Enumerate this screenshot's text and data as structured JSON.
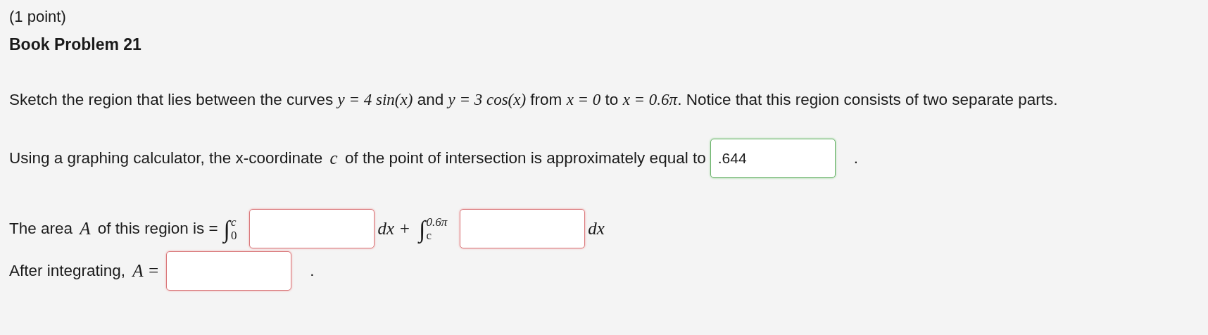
{
  "points": "(1 point)",
  "title": "Book Problem 21",
  "intro": [
    {
      "kind": "text",
      "text": "Sketch the region that lies between the curves "
    },
    {
      "kind": "math",
      "text": "y = 4 sin(x)"
    },
    {
      "kind": "text",
      "text": " and "
    },
    {
      "kind": "math",
      "text": "y = 3 cos(x)"
    },
    {
      "kind": "text",
      "text": " from "
    },
    {
      "kind": "math",
      "text": "x = 0"
    },
    {
      "kind": "text",
      "text": " to "
    },
    {
      "kind": "math",
      "text": "x = 0.6π"
    },
    {
      "kind": "text",
      "text": ". Notice that this region consists of two separate parts."
    }
  ],
  "rows": [
    {
      "parts": [
        {
          "kind": "text",
          "text": "Using a graphing calculator, the x-coordinate "
        },
        {
          "kind": "math",
          "text": "c"
        },
        {
          "kind": "text",
          "text": " of the point of intersection is approximately equal to"
        },
        {
          "kind": "field",
          "value": ".644",
          "correct": true
        },
        {
          "kind": "period",
          "text": "."
        }
      ]
    },
    {
      "parts": [
        {
          "kind": "text",
          "text": "The area "
        },
        {
          "kind": "math",
          "text": "A"
        },
        {
          "kind": "text",
          "text": " of this region is ="
        },
        {
          "kind": "integral",
          "sign": "∫",
          "upper": "c",
          "lower": "0"
        },
        {
          "kind": "field",
          "correct": false
        },
        {
          "kind": "math",
          "text": "dx +"
        },
        {
          "kind": "integral",
          "sign": "∫",
          "upper": "0.6π",
          "lower": "c"
        },
        {
          "kind": "field",
          "correct": false
        },
        {
          "kind": "math",
          "text": "dx"
        }
      ]
    },
    {
      "parts": [
        {
          "kind": "text",
          "text": "After integrating, "
        },
        {
          "kind": "math",
          "text": "A ="
        },
        {
          "kind": "field",
          "correct": false
        },
        {
          "kind": "period",
          "text": "."
        }
      ]
    }
  ]
}
